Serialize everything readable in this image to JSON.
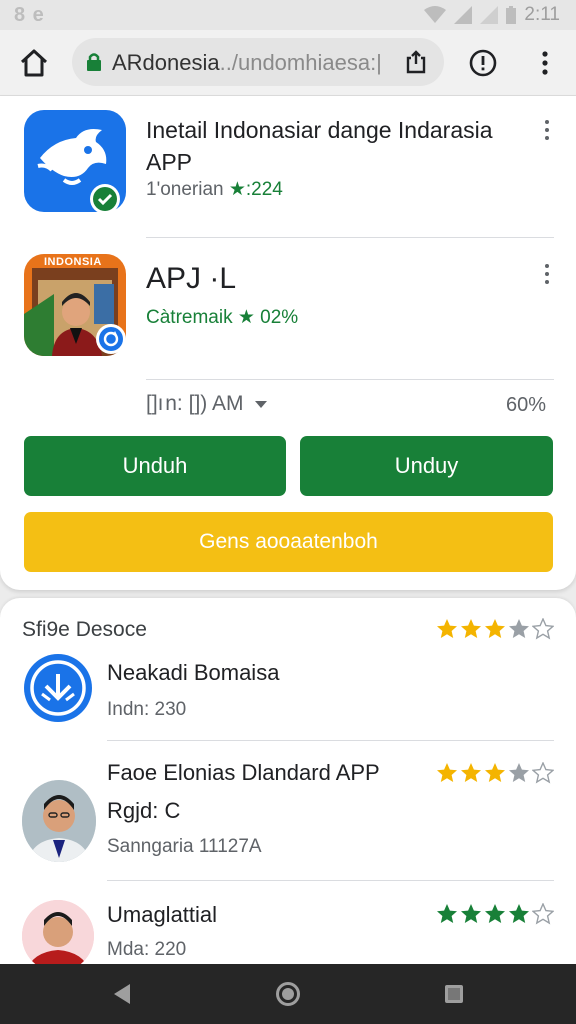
{
  "status_bar": {
    "left_icons": "8 e",
    "time": "2:11"
  },
  "browser": {
    "url_main": "ARdonesia",
    "url_rest": "../undomhiaesa:|"
  },
  "app1": {
    "title": "Inetail Indonasiar dange Indarasia APP",
    "meta_text": "1'onerian",
    "rating": "★:224"
  },
  "app2": {
    "title": "APJ ·L",
    "icon_label": "INDONSIA",
    "meta_text": "Càtremaik",
    "rating": "★ 02%"
  },
  "selector": {
    "label": "[]ı n: []) AM",
    "percent": "60%"
  },
  "buttons": {
    "download_1": "Unduh",
    "download_2": "Unduy",
    "secondary": "Gens aooaatenboh"
  },
  "section": {
    "title": "Sfi9e Desoce"
  },
  "list": [
    {
      "title": "Neakadi Bomaisa",
      "sub": "Indn: 230",
      "rating": 3.5
    },
    {
      "title": "Faoe Elonias Dlandard APP",
      "line2": "Rgjd: C",
      "sub": "Sanngaria 11127A",
      "rating": 3.5
    },
    {
      "title": "Umaglattial",
      "sub": "Mda: 220",
      "rating": 4
    }
  ],
  "colors": {
    "green": "#188038",
    "yellow": "#f4bf14",
    "blue": "#1a73e8",
    "star_gold": "#f4b400",
    "star_green": "#188038"
  }
}
